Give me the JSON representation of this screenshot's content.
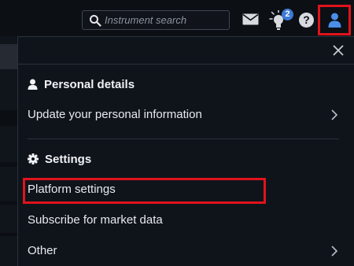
{
  "header": {
    "search": {
      "placeholder": "Instrument search"
    },
    "notifications_badge": "2",
    "help_label": "?",
    "icons": [
      "search-icon",
      "mail-icon",
      "lightbulb-icon",
      "help-icon",
      "user-icon"
    ]
  },
  "menu": {
    "personal": {
      "title": "Personal details",
      "items": [
        {
          "label": "Update your personal information",
          "has_submenu": true
        }
      ]
    },
    "settings": {
      "title": "Settings",
      "items": [
        {
          "label": "Platform settings",
          "has_submenu": false,
          "highlighted": true
        },
        {
          "label": "Subscribe for market data",
          "has_submenu": false
        },
        {
          "label": "Other",
          "has_submenu": true
        }
      ]
    }
  },
  "colors": {
    "highlight": "#e0131b",
    "accent_blue": "#3d7ad6",
    "panel_bg": "#0f141b",
    "topbar_bg": "#0c0f14"
  }
}
